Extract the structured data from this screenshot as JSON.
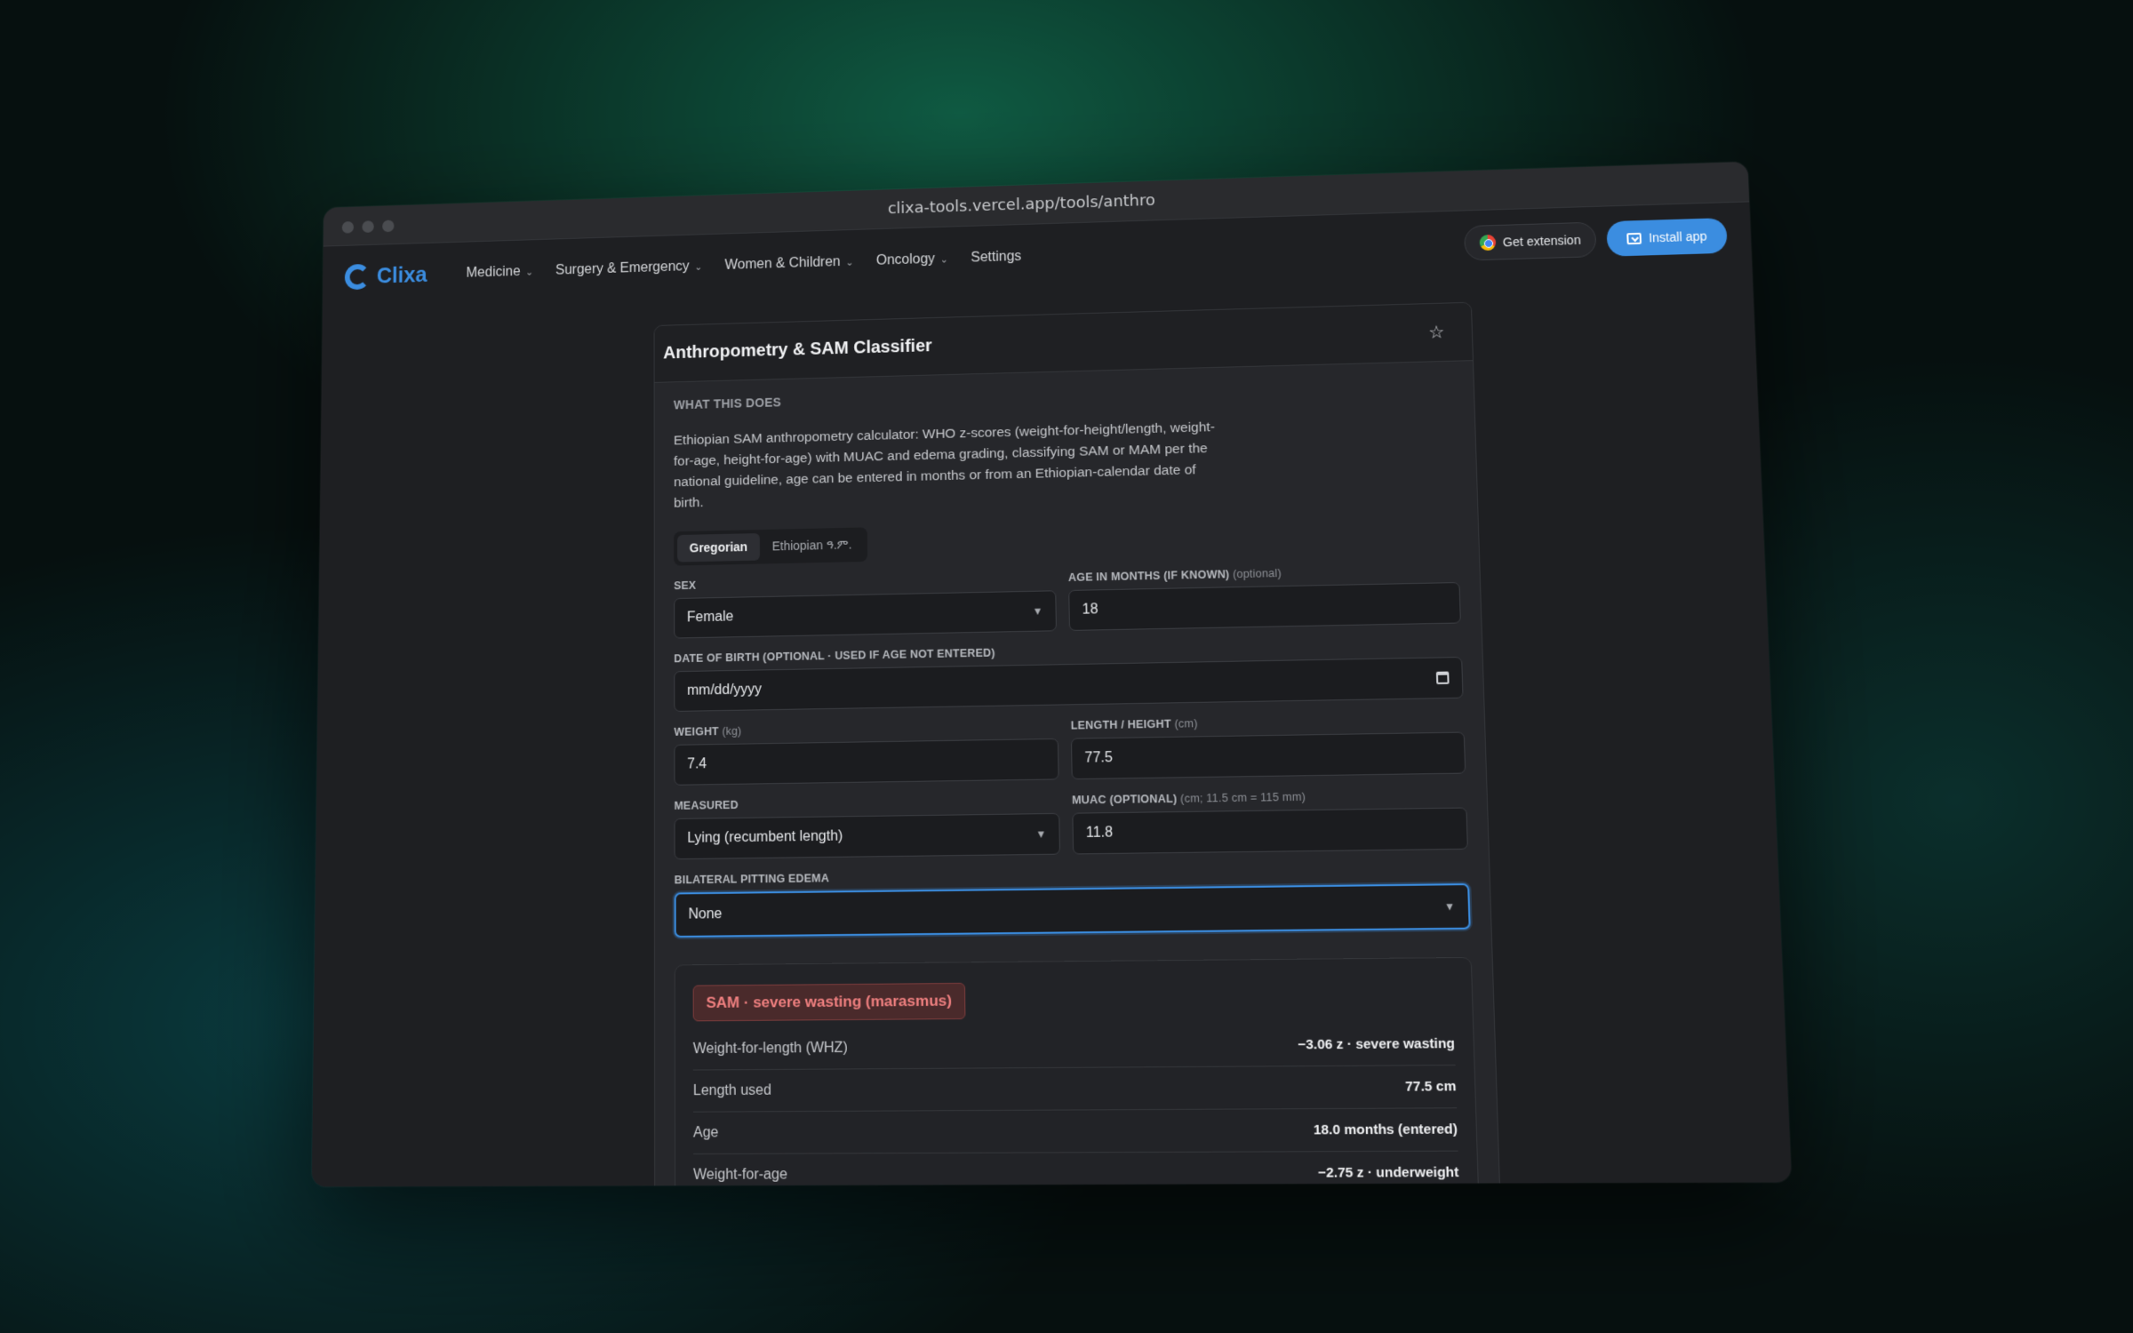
{
  "browser": {
    "url": "clixa-tools.vercel.app/tools/anthro"
  },
  "nav": {
    "logo_text": "Clixa",
    "items": [
      {
        "label": "Medicine",
        "has_dropdown": true
      },
      {
        "label": "Surgery & Emergency",
        "has_dropdown": true
      },
      {
        "label": "Women & Children",
        "has_dropdown": true
      },
      {
        "label": "Oncology",
        "has_dropdown": true
      },
      {
        "label": "Settings",
        "has_dropdown": false
      }
    ],
    "get_extension": "Get extension",
    "install_app": "Install app",
    "accent": "#3b8de0"
  },
  "card": {
    "title": "Anthropometry & SAM Classifier",
    "what_label": "WHAT THIS DOES",
    "description": "Ethiopian SAM anthropometry calculator: WHO z-scores (weight-for-height/length, weight-for-age, height-for-age) with MUAC and edema grading, classifying SAM or MAM per the national guideline, age can be entered in months or from an Ethiopian-calendar date of birth.",
    "tabs": [
      "Gregorian",
      "Ethiopian ዓ.ም."
    ],
    "active_tab": 0
  },
  "form": {
    "sex": {
      "label": "SEX",
      "value": "Female"
    },
    "age": {
      "label": "AGE IN MONTHS (IF KNOWN)",
      "note": "(optional)",
      "value": "18"
    },
    "dob": {
      "label": "DATE OF BIRTH (OPTIONAL · USED IF AGE NOT ENTERED)",
      "placeholder": "mm/dd/yyyy"
    },
    "weight": {
      "label": "WEIGHT",
      "unit": "(kg)",
      "value": "7.4"
    },
    "length": {
      "label": "LENGTH / HEIGHT",
      "unit": "(cm)",
      "value": "77.5"
    },
    "measured": {
      "label": "MEASURED",
      "value": "Lying (recumbent length)"
    },
    "muac": {
      "label": "MUAC (OPTIONAL)",
      "unit": "(cm; 11.5 cm = 115 mm)",
      "value": "11.8"
    },
    "edema": {
      "label": "BILATERAL PITTING EDEMA",
      "value": "None"
    }
  },
  "result": {
    "badge": "SAM · severe wasting (marasmus)",
    "badge_color": "#f08080",
    "rows": [
      {
        "k": "Weight-for-length (WHZ)",
        "v": "−3.06 z · severe wasting"
      },
      {
        "k": "Length used",
        "v": "77.5 cm"
      },
      {
        "k": "Age",
        "v": "18.0 months (entered)"
      },
      {
        "k": "Weight-for-age",
        "v": "−2.75 z · underweight"
      }
    ]
  }
}
